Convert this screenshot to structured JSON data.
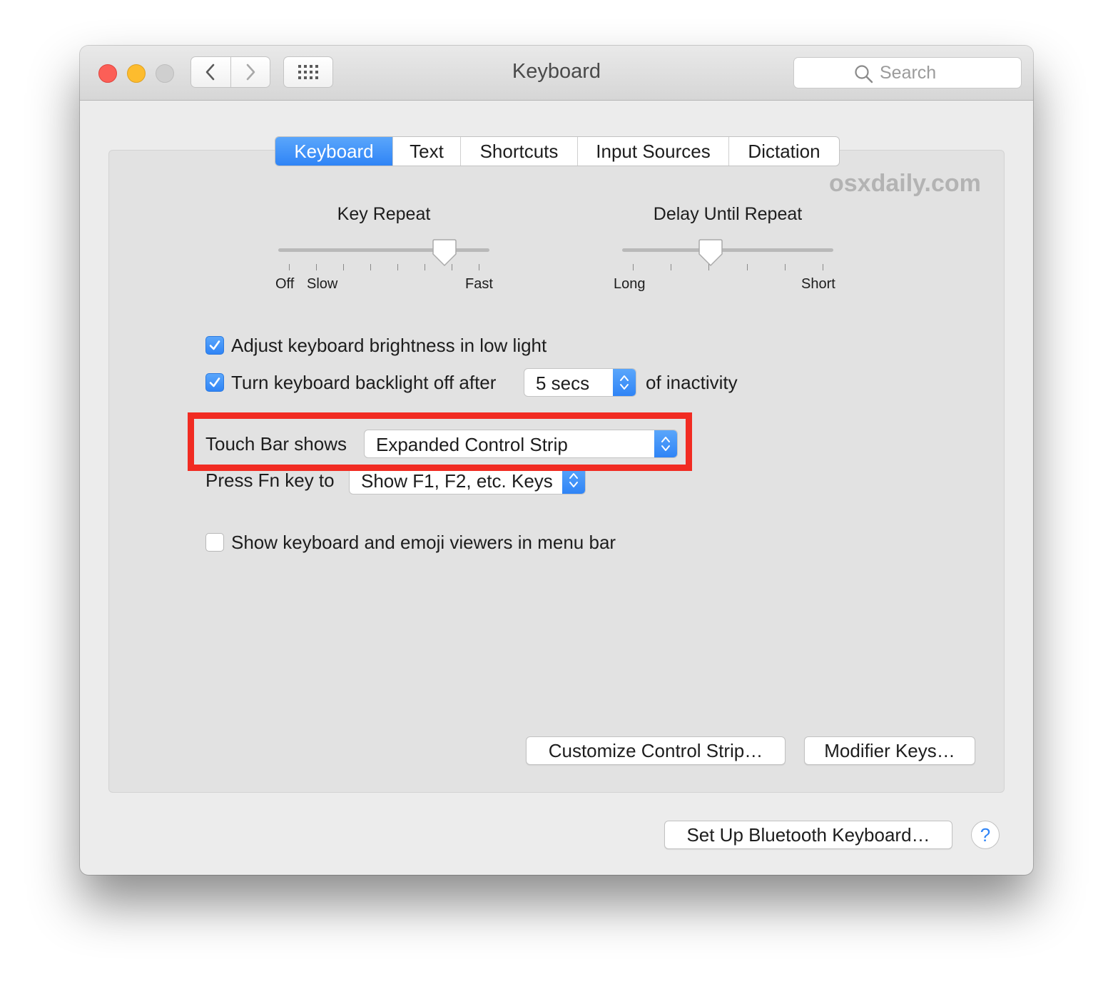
{
  "window": {
    "title": "Keyboard",
    "search_placeholder": "Search",
    "traffic_light_colors": {
      "close": "#fc5f57",
      "minimize": "#fdbc2e",
      "zoom": "#cfcfcf"
    }
  },
  "tabs": [
    {
      "label": "Keyboard",
      "active": true
    },
    {
      "label": "Text",
      "active": false
    },
    {
      "label": "Shortcuts",
      "active": false
    },
    {
      "label": "Input Sources",
      "active": false
    },
    {
      "label": "Dictation",
      "active": false
    }
  ],
  "watermark": "osxdaily.com",
  "key_repeat": {
    "title": "Key Repeat",
    "labels": [
      "Off",
      "Slow",
      "Fast"
    ],
    "tick_count": 8,
    "value": 0.82
  },
  "delay_until_repeat": {
    "title": "Delay Until Repeat",
    "labels": [
      "Long",
      "Short"
    ],
    "tick_count": 6,
    "value": 0.41
  },
  "options": {
    "brightness": {
      "label": "Adjust keyboard brightness in low light",
      "checked": true
    },
    "backlight": {
      "label": "Turn keyboard backlight off after",
      "checked": true,
      "value": "5 secs",
      "suffix": "of inactivity"
    },
    "touch_bar": {
      "label": "Touch Bar shows",
      "value": "Expanded Control Strip"
    },
    "fn_key": {
      "label": "Press Fn key to",
      "value": "Show F1, F2, etc. Keys"
    },
    "emoji_viewer": {
      "label": "Show keyboard and emoji viewers in menu bar",
      "checked": false
    }
  },
  "buttons": {
    "customize": "Customize Control Strip…",
    "modifier": "Modifier Keys…",
    "bluetooth": "Set Up Bluetooth Keyboard…",
    "help": "?"
  },
  "accent_color": "#2f84f6",
  "highlight_color": "#f12b22"
}
